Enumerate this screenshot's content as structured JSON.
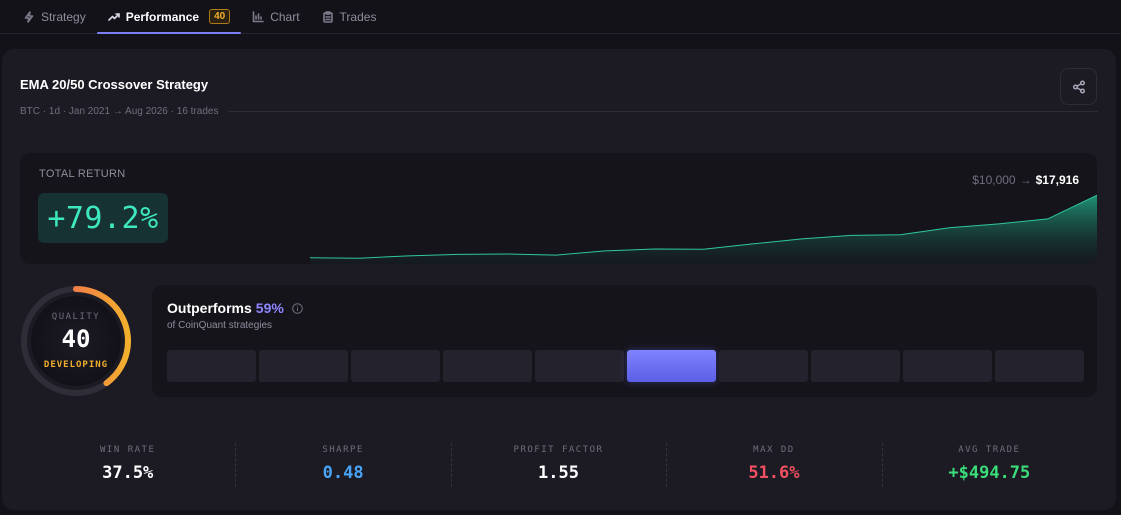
{
  "tabs": [
    {
      "label": "Strategy",
      "icon": "bolt-icon",
      "active": false
    },
    {
      "label": "Performance",
      "icon": "trending-up-icon",
      "active": true,
      "badge": "40"
    },
    {
      "label": "Chart",
      "icon": "bar-chart-icon",
      "active": false
    },
    {
      "label": "Trades",
      "icon": "clipboard-icon",
      "active": false
    }
  ],
  "strategy": {
    "title": "EMA 20/50 Crossover Strategy",
    "subtitle": "BTC · 1d · Jan 2021 → Aug 2026 · 16 trades"
  },
  "total_return": {
    "label": "TOTAL RETURN",
    "value": "+79.2%",
    "start_capital": "$10,000",
    "arrow": "→",
    "end_capital": "$17,916",
    "equity_curve": [
      9800,
      9750,
      10050,
      10250,
      10300,
      10150,
      10700,
      10950,
      10900,
      11600,
      12250,
      12700,
      12800,
      13700,
      14200,
      14850,
      17916
    ]
  },
  "quality": {
    "caption": "QUALITY",
    "score": 40,
    "max_score": 100,
    "status": "DEVELOPING"
  },
  "outperforms": {
    "label": "Outperforms",
    "percent": "59%",
    "subtitle": "of CoinQuant strategies",
    "decile_count": 10,
    "active_decile": 5
  },
  "stats": [
    {
      "label": "WIN RATE",
      "value": "37.5%",
      "color": "#ffffff"
    },
    {
      "label": "SHARPE",
      "value": "0.48",
      "color": "#4aa3f5"
    },
    {
      "label": "PROFIT FACTOR",
      "value": "1.55",
      "color": "#ffffff"
    },
    {
      "label": "MAX DD",
      "value": "51.6%",
      "color": "#f0505f"
    },
    {
      "label": "AVG TRADE",
      "value": "+$494.75",
      "color": "#3bdc7a"
    }
  ],
  "colors": {
    "accent": "#7c7ff3",
    "return_green": "#3ee8bf",
    "ring_start": "#f0505f",
    "ring_end": "#f2b02d"
  }
}
